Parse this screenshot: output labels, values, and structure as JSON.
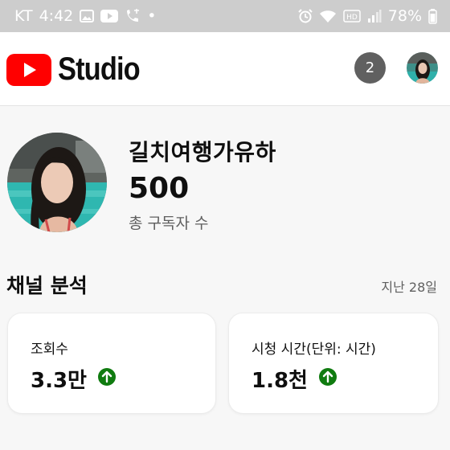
{
  "status_bar": {
    "carrier": "KT",
    "time": "4:42",
    "battery": "78%",
    "dot": "•",
    "hd_label": "HD",
    "bar_color": "#cdcdcd"
  },
  "app_bar": {
    "title": "Studio",
    "notification_count": "2",
    "logo_color": "#ff0000"
  },
  "channel": {
    "name": "길치여행가유하",
    "subscribers": "500",
    "subscribers_label": "총 구독자 수"
  },
  "analytics": {
    "title": "채널 분석",
    "period": "지난 28일",
    "cards": [
      {
        "label": "조회수",
        "value": "3.3만",
        "trend_icon": "arrow-up-icon"
      },
      {
        "label": "시청 시간(단위: 시간)",
        "value": "1.8천",
        "trend_icon": "arrow-up-icon"
      }
    ],
    "trend_color": "#0f7b0f"
  }
}
